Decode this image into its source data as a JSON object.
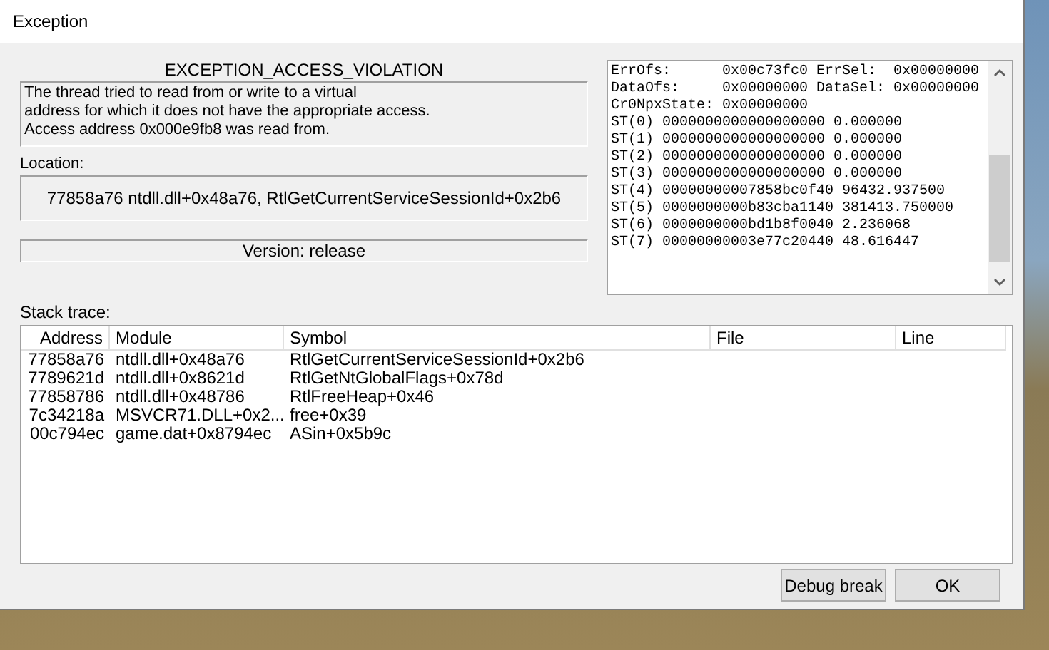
{
  "window": {
    "title": "Exception"
  },
  "exception": {
    "name": "EXCEPTION_ACCESS_VIOLATION",
    "description_lines": [
      "The thread tried to read from or write to a virtual",
      "address for which it does not have the appropriate access.",
      "Access address 0x000e9fb8 was read from."
    ]
  },
  "location": {
    "label": "Location:",
    "value": "77858a76 ntdll.dll+0x48a76, RtlGetCurrentServiceSessionId+0x2b6"
  },
  "version": "Version: release",
  "registers": [
    "ErrOfs:      0x00c73fc0 ErrSel:  0x00000000",
    "DataOfs:     0x00000000 DataSel: 0x00000000",
    "Cr0NpxState: 0x00000000",
    "ST(0) 0000000000000000000 0.000000",
    "ST(1) 0000000000000000000 0.000000",
    "ST(2) 0000000000000000000 0.000000",
    "ST(3) 0000000000000000000 0.000000",
    "ST(4) 00000000007858bc0f40 96432.937500",
    "ST(5) 0000000000b83cba1140 381413.750000",
    "ST(6) 0000000000bd1b8f0040 2.236068",
    "ST(7) 00000000003e77c20440 48.616447"
  ],
  "stack_trace": {
    "label": "Stack trace:",
    "columns": [
      "Address",
      "Module",
      "Symbol",
      "File",
      "Line"
    ],
    "rows": [
      [
        "77858a76",
        "ntdll.dll+0x48a76",
        "RtlGetCurrentServiceSessionId+0x2b6",
        "",
        ""
      ],
      [
        "7789621d",
        "ntdll.dll+0x8621d",
        "RtlGetNtGlobalFlags+0x78d",
        "",
        ""
      ],
      [
        "77858786",
        "ntdll.dll+0x48786",
        "RtlFreeHeap+0x46",
        "",
        ""
      ],
      [
        "7c34218a",
        "MSVCR71.DLL+0x2...",
        "free+0x39",
        "",
        ""
      ],
      [
        "00c794ec",
        "game.dat+0x8794ec",
        "ASin+0x5b9c",
        "",
        ""
      ]
    ]
  },
  "buttons": [
    "Debug break",
    "OK"
  ]
}
